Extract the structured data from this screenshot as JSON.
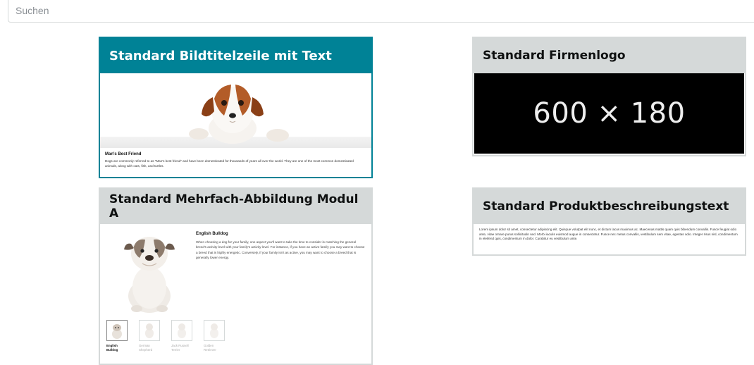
{
  "search": {
    "placeholder": "Suchen"
  },
  "cards": [
    {
      "title": "Standard Bildtitelzeile mit Text",
      "selected": true,
      "preview_title": "Man's Best Friend",
      "preview_body": "Dogs are commonly referred to as \"Man's best friend\" and have been domesticated for thousands of years all over the world. They are one of the most common domesticated animals, along with cats, fish, and turtles."
    },
    {
      "title": "Standard Firmenlogo",
      "preview_placeholder": "600 × 180"
    },
    {
      "title": "Standard Mehrfach-Abbildung Modul A",
      "preview_title": "English Bulldog",
      "preview_body": "When choosing a dog for your family, one aspect you'll want to take the time to consider is matching the general breed's activity level with your family's activity level. For instance, if you have an active family you may want to choose a breed that is highly energetic. Conversely, if your family isn't as active, you may want to choose a breed that is generally lower energy.",
      "thumbnails": [
        {
          "label_1": "English",
          "label_2": "Bulldog",
          "active": true
        },
        {
          "label_1": "German",
          "label_2": "Shepherd",
          "active": false
        },
        {
          "label_1": "Jack Russell",
          "label_2": "Terrier",
          "active": false
        },
        {
          "label_1": "Golden",
          "label_2": "Retriever",
          "active": false
        }
      ]
    },
    {
      "title": "Standard Produktbeschreibungstext",
      "preview_body": "Lorem ipsum dolor sit amet, consectetur adipiscing elit. Quisque volutpat elit nunc, et dictum lacus maximus ac. Maecenas mattis quam quis bibendum convallis. Fusce feugiat odio ante, vitae ornare purus sollicitudin sed. Morbi iaculis euismod augue in consectetur. Fusce nec metus convallis, vestibulum sem vitae, egestas odio. Integer risus nisl, condimentum in eleifend quis, condimentum in dolor. Curabitur eu vestibulum ante."
    }
  ],
  "colors": {
    "accent": "#008296",
    "header_gray": "#d5d9d9"
  }
}
